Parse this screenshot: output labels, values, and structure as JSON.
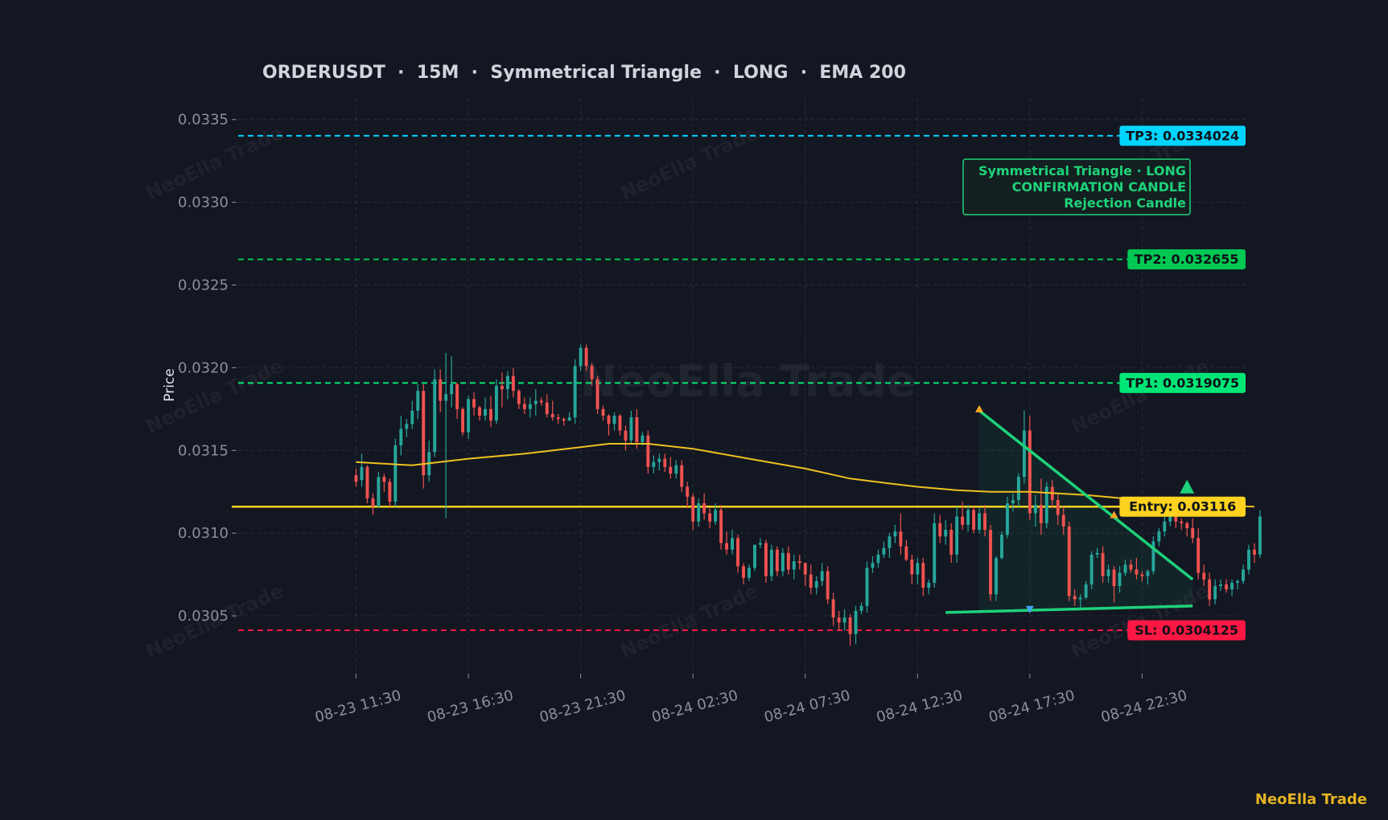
{
  "chart_data": {
    "type": "candlestick",
    "title": "ORDERUSDT  ·  15M  ·  Symmetrical Triangle  ·  LONG  ·  EMA 200",
    "ylabel": "Price",
    "ylim": [
      0.03016,
      0.03363
    ],
    "y_ticks": [
      "0.0305",
      "0.0310",
      "0.0315",
      "0.0320",
      "0.0325",
      "0.0330",
      "0.0335"
    ],
    "x_ticks": [
      "08-23 11:30",
      "08-23 16:30",
      "08-23 21:30",
      "08-24 02:30",
      "08-24 07:30",
      "08-24 12:30",
      "08-24 17:30",
      "08-24 22:30"
    ],
    "x_tick_index": [
      0,
      20,
      40,
      60,
      80,
      100,
      120,
      140
    ],
    "xlim": [
      -21,
      159
    ],
    "grid": true,
    "colors": {
      "up": "#26a69a",
      "down": "#ef5350",
      "ema": "#f0c020",
      "entry": "#ffd21f",
      "tp3": "#00d4ff",
      "tp2": "#00c853",
      "tp1": "#00e676",
      "sl": "#ff1744",
      "pattern": "#1ed27a",
      "brand": "#e6b422"
    },
    "candles": [
      [
        0.03135,
        0.03139,
        0.03128,
        0.03131
      ],
      [
        0.03132,
        0.03148,
        0.03128,
        0.0314
      ],
      [
        0.0314,
        0.03141,
        0.03118,
        0.03121
      ],
      [
        0.03121,
        0.03124,
        0.03111,
        0.03116
      ],
      [
        0.03116,
        0.03137,
        0.03116,
        0.03134
      ],
      [
        0.03134,
        0.03136,
        0.03125,
        0.03131
      ],
      [
        0.03131,
        0.03133,
        0.03116,
        0.03119
      ],
      [
        0.03119,
        0.03157,
        0.03116,
        0.03153
      ],
      [
        0.03153,
        0.03171,
        0.03147,
        0.03163
      ],
      [
        0.03163,
        0.03169,
        0.03158,
        0.03166
      ],
      [
        0.03166,
        0.0318,
        0.03163,
        0.03174
      ],
      [
        0.03174,
        0.0319,
        0.03169,
        0.03186
      ],
      [
        0.03186,
        0.0319,
        0.03127,
        0.03135
      ],
      [
        0.03135,
        0.03156,
        0.03131,
        0.03149
      ],
      [
        0.03149,
        0.03199,
        0.03146,
        0.03193
      ],
      [
        0.03193,
        0.03199,
        0.03173,
        0.0318
      ],
      [
        0.0318,
        0.03209,
        0.03109,
        0.03184
      ],
      [
        0.03184,
        0.03207,
        0.03176,
        0.0319
      ],
      [
        0.0319,
        0.03191,
        0.03169,
        0.03175
      ],
      [
        0.03175,
        0.03176,
        0.03159,
        0.03161
      ],
      [
        0.03161,
        0.03183,
        0.03157,
        0.03181
      ],
      [
        0.03181,
        0.03185,
        0.03171,
        0.03176
      ],
      [
        0.03176,
        0.03177,
        0.03168,
        0.03171
      ],
      [
        0.03171,
        0.03182,
        0.03168,
        0.03175
      ],
      [
        0.03175,
        0.03183,
        0.03164,
        0.03168
      ],
      [
        0.03168,
        0.03193,
        0.03166,
        0.03189
      ],
      [
        0.03189,
        0.03197,
        0.03176,
        0.03187
      ],
      [
        0.03187,
        0.03198,
        0.03181,
        0.03195
      ],
      [
        0.03195,
        0.032,
        0.03182,
        0.03186
      ],
      [
        0.03186,
        0.03187,
        0.03175,
        0.03178
      ],
      [
        0.03178,
        0.03182,
        0.03172,
        0.03175
      ],
      [
        0.03175,
        0.03182,
        0.0317,
        0.03178
      ],
      [
        0.03178,
        0.03187,
        0.03171,
        0.0318
      ],
      [
        0.0318,
        0.03182,
        0.03177,
        0.03179
      ],
      [
        0.03179,
        0.03184,
        0.0317,
        0.03172
      ],
      [
        0.03172,
        0.0318,
        0.03168,
        0.0317
      ],
      [
        0.0317,
        0.03172,
        0.03166,
        0.03169
      ],
      [
        0.03169,
        0.0317,
        0.03165,
        0.03168
      ],
      [
        0.03168,
        0.03173,
        0.03168,
        0.0317
      ],
      [
        0.0317,
        0.03205,
        0.03166,
        0.03201
      ],
      [
        0.03201,
        0.03214,
        0.03198,
        0.03212
      ],
      [
        0.03212,
        0.03214,
        0.03198,
        0.03201
      ],
      [
        0.03201,
        0.03203,
        0.03189,
        0.03193
      ],
      [
        0.03193,
        0.03195,
        0.03172,
        0.03175
      ],
      [
        0.03175,
        0.03177,
        0.03168,
        0.03171
      ],
      [
        0.03171,
        0.03172,
        0.03159,
        0.03166
      ],
      [
        0.03166,
        0.03173,
        0.03162,
        0.03171
      ],
      [
        0.03171,
        0.03172,
        0.03159,
        0.03162
      ],
      [
        0.03162,
        0.03165,
        0.0315,
        0.03156
      ],
      [
        0.03156,
        0.03174,
        0.03154,
        0.0317
      ],
      [
        0.0317,
        0.03175,
        0.03151,
        0.03155
      ],
      [
        0.03155,
        0.03161,
        0.03153,
        0.03159
      ],
      [
        0.03159,
        0.03162,
        0.03136,
        0.0314
      ],
      [
        0.0314,
        0.03147,
        0.03136,
        0.03143
      ],
      [
        0.03143,
        0.03148,
        0.03138,
        0.03145
      ],
      [
        0.03145,
        0.03148,
        0.03137,
        0.0314
      ],
      [
        0.0314,
        0.03146,
        0.03133,
        0.03136
      ],
      [
        0.03136,
        0.03144,
        0.03133,
        0.03141
      ],
      [
        0.03141,
        0.03144,
        0.03125,
        0.03128
      ],
      [
        0.03128,
        0.03131,
        0.03115,
        0.03122
      ],
      [
        0.03122,
        0.03124,
        0.03102,
        0.03107
      ],
      [
        0.03107,
        0.03121,
        0.03104,
        0.03118
      ],
      [
        0.03118,
        0.03124,
        0.03108,
        0.03112
      ],
      [
        0.03112,
        0.03115,
        0.03103,
        0.03107
      ],
      [
        0.03107,
        0.03118,
        0.03105,
        0.03114
      ],
      [
        0.03114,
        0.03117,
        0.0309,
        0.03094
      ],
      [
        0.03094,
        0.03101,
        0.03087,
        0.0309
      ],
      [
        0.0309,
        0.03102,
        0.03087,
        0.03097
      ],
      [
        0.03097,
        0.03099,
        0.03076,
        0.0308
      ],
      [
        0.0308,
        0.03082,
        0.03069,
        0.03073
      ],
      [
        0.03073,
        0.03081,
        0.03071,
        0.03079
      ],
      [
        0.03079,
        0.03093,
        0.03077,
        0.03093
      ],
      [
        0.03093,
        0.03097,
        0.03091,
        0.03094
      ],
      [
        0.03094,
        0.03096,
        0.0307,
        0.03074
      ],
      [
        0.03074,
        0.03093,
        0.03071,
        0.0309
      ],
      [
        0.0309,
        0.03092,
        0.03074,
        0.03077
      ],
      [
        0.03077,
        0.03091,
        0.03074,
        0.03088
      ],
      [
        0.03088,
        0.03092,
        0.03075,
        0.03078
      ],
      [
        0.03078,
        0.03087,
        0.03072,
        0.03083
      ],
      [
        0.03083,
        0.03087,
        0.03078,
        0.03082
      ],
      [
        0.03082,
        0.0308,
        0.03068,
        0.03075
      ],
      [
        0.03075,
        0.03081,
        0.03063,
        0.03067
      ],
      [
        0.03067,
        0.03074,
        0.03063,
        0.03071
      ],
      [
        0.03071,
        0.03082,
        0.03068,
        0.03077
      ],
      [
        0.03077,
        0.0308,
        0.03057,
        0.0306
      ],
      [
        0.0306,
        0.03064,
        0.03044,
        0.03049
      ],
      [
        0.03049,
        0.03053,
        0.03041,
        0.03046
      ],
      [
        0.03046,
        0.03054,
        0.03041,
        0.03049
      ],
      [
        0.03049,
        0.03051,
        0.03032,
        0.03039
      ],
      [
        0.03039,
        0.03056,
        0.03033,
        0.03053
      ],
      [
        0.03053,
        0.03058,
        0.03051,
        0.03056
      ],
      [
        0.03056,
        0.03083,
        0.03052,
        0.03079
      ],
      [
        0.03079,
        0.03086,
        0.03076,
        0.03082
      ],
      [
        0.03082,
        0.0309,
        0.03079,
        0.03087
      ],
      [
        0.03087,
        0.03095,
        0.03085,
        0.03091
      ],
      [
        0.03091,
        0.031,
        0.03085,
        0.03098
      ],
      [
        0.03098,
        0.03105,
        0.03094,
        0.03101
      ],
      [
        0.03101,
        0.03112,
        0.03087,
        0.03092
      ],
      [
        0.03092,
        0.03096,
        0.03083,
        0.03084
      ],
      [
        0.03084,
        0.03087,
        0.03069,
        0.03075
      ],
      [
        0.03075,
        0.03085,
        0.03069,
        0.03082
      ],
      [
        0.03082,
        0.03085,
        0.03062,
        0.03067
      ],
      [
        0.03067,
        0.03072,
        0.03063,
        0.0307
      ],
      [
        0.0307,
        0.03112,
        0.03067,
        0.03106
      ],
      [
        0.03106,
        0.03111,
        0.03094,
        0.03098
      ],
      [
        0.03098,
        0.03108,
        0.03093,
        0.03102
      ],
      [
        0.03102,
        0.03106,
        0.03082,
        0.03087
      ],
      [
        0.03087,
        0.03116,
        0.03082,
        0.0311
      ],
      [
        0.0311,
        0.03119,
        0.03102,
        0.03105
      ],
      [
        0.03105,
        0.03117,
        0.03101,
        0.03114
      ],
      [
        0.03114,
        0.03116,
        0.031,
        0.03102
      ],
      [
        0.03102,
        0.03115,
        0.031,
        0.03112
      ],
      [
        0.03112,
        0.03117,
        0.03098,
        0.03102
      ],
      [
        0.03102,
        0.03105,
        0.03059,
        0.03063
      ],
      [
        0.03063,
        0.03086,
        0.03059,
        0.03085
      ],
      [
        0.03085,
        0.03101,
        0.03084,
        0.03099
      ],
      [
        0.03099,
        0.03122,
        0.03097,
        0.03118
      ],
      [
        0.03118,
        0.03124,
        0.03113,
        0.0312
      ],
      [
        0.0312,
        0.03136,
        0.03116,
        0.03134
      ],
      [
        0.03134,
        0.03174,
        0.0313,
        0.03162
      ],
      [
        0.03162,
        0.03171,
        0.03108,
        0.03112
      ],
      [
        0.03112,
        0.03123,
        0.03104,
        0.03117
      ],
      [
        0.03117,
        0.03133,
        0.03099,
        0.03106
      ],
      [
        0.03106,
        0.03131,
        0.03103,
        0.03128
      ],
      [
        0.03128,
        0.03132,
        0.03115,
        0.0312
      ],
      [
        0.0312,
        0.03124,
        0.03105,
        0.03111
      ],
      [
        0.03111,
        0.03116,
        0.03099,
        0.03104
      ],
      [
        0.03104,
        0.03107,
        0.03059,
        0.03062
      ],
      [
        0.03062,
        0.03066,
        0.03056,
        0.0306
      ],
      [
        0.0306,
        0.03063,
        0.03055,
        0.03061
      ],
      [
        0.03061,
        0.03071,
        0.0306,
        0.03069
      ],
      [
        0.03069,
        0.03089,
        0.03066,
        0.03087
      ],
      [
        0.03087,
        0.03091,
        0.03085,
        0.03088
      ],
      [
        0.03088,
        0.03092,
        0.0307,
        0.03074
      ],
      [
        0.03074,
        0.03081,
        0.0307,
        0.03078
      ],
      [
        0.03078,
        0.0308,
        0.03058,
        0.03068
      ],
      [
        0.03068,
        0.0308,
        0.03064,
        0.03076
      ],
      [
        0.03076,
        0.03084,
        0.03074,
        0.03081
      ],
      [
        0.03081,
        0.03084,
        0.03076,
        0.03078
      ],
      [
        0.03078,
        0.03085,
        0.03072,
        0.03075
      ],
      [
        0.03075,
        0.03077,
        0.03071,
        0.03074
      ],
      [
        0.03074,
        0.03078,
        0.03069,
        0.03077
      ],
      [
        0.03077,
        0.03098,
        0.03075,
        0.03095
      ],
      [
        0.03095,
        0.03103,
        0.03092,
        0.03101
      ],
      [
        0.03101,
        0.0311,
        0.03098,
        0.03107
      ],
      [
        0.03107,
        0.03114,
        0.03104,
        0.03112
      ],
      [
        0.03112,
        0.03113,
        0.03103,
        0.03107
      ],
      [
        0.03107,
        0.03109,
        0.03102,
        0.03106
      ],
      [
        0.03106,
        0.03107,
        0.03098,
        0.03103
      ],
      [
        0.03103,
        0.03109,
        0.03094,
        0.03097
      ],
      [
        0.03097,
        0.03103,
        0.03072,
        0.03076
      ],
      [
        0.03076,
        0.03081,
        0.03068,
        0.03072
      ],
      [
        0.03072,
        0.03076,
        0.03056,
        0.0306
      ],
      [
        0.0306,
        0.03072,
        0.03057,
        0.03068
      ],
      [
        0.03068,
        0.03072,
        0.03065,
        0.03069
      ],
      [
        0.03069,
        0.03072,
        0.03064,
        0.03066
      ],
      [
        0.03066,
        0.03072,
        0.03062,
        0.0307
      ],
      [
        0.0307,
        0.03072,
        0.03066,
        0.03071
      ],
      [
        0.03071,
        0.03081,
        0.03069,
        0.03078
      ],
      [
        0.03078,
        0.03093,
        0.03075,
        0.0309
      ],
      [
        0.0309,
        0.03094,
        0.03082,
        0.03087
      ],
      [
        0.03087,
        0.03114,
        0.03085,
        0.0311
      ]
    ],
    "ema": {
      "name": "EMA 200",
      "points": [
        [
          0,
          0.03143
        ],
        [
          10,
          0.03141
        ],
        [
          20,
          0.03145
        ],
        [
          30,
          0.03148
        ],
        [
          40,
          0.03152
        ],
        [
          45,
          0.03154
        ],
        [
          52,
          0.03154
        ],
        [
          60,
          0.03151
        ],
        [
          70,
          0.03145
        ],
        [
          80,
          0.03139
        ],
        [
          88,
          0.03133
        ],
        [
          95,
          0.0313
        ],
        [
          100,
          0.03128
        ],
        [
          107,
          0.03126
        ],
        [
          113,
          0.03125
        ],
        [
          120,
          0.03125
        ],
        [
          130,
          0.03123
        ],
        [
          140,
          0.0312
        ],
        [
          150,
          0.03117
        ],
        [
          160,
          0.03116
        ]
      ]
    },
    "levels": [
      {
        "key": "tp3",
        "label": "TP3: 0.0334024",
        "value": 0.0334024,
        "style": "dashed"
      },
      {
        "key": "tp2",
        "label": "TP2: 0.032655",
        "value": 0.032655,
        "style": "dashed"
      },
      {
        "key": "tp1",
        "label": "TP1: 0.0319075",
        "value": 0.0319075,
        "style": "dashed"
      },
      {
        "key": "entry",
        "label": "Entry: 0.03116",
        "value": 0.03116,
        "style": "solid"
      },
      {
        "key": "sl",
        "label": "SL: 0.0304125",
        "value": 0.0304125,
        "style": "dashed"
      }
    ],
    "triangle": {
      "upper": [
        [
          111,
          0.03174
        ],
        [
          149,
          0.03072
        ]
      ],
      "lower": [
        [
          105,
          0.03052
        ],
        [
          149,
          0.03056
        ]
      ],
      "fill_from_x": 111
    },
    "markers": [
      {
        "type": "pivot-high",
        "x": 111,
        "y": 0.03175
      },
      {
        "type": "pivot-low",
        "x": 120,
        "y": 0.03054
      },
      {
        "type": "pivot-high",
        "x": 135,
        "y": 0.03111
      },
      {
        "type": "long-signal",
        "x": 148,
        "y": 0.03124
      }
    ],
    "annotation": [
      "Symmetrical Triangle · LONG",
      "CONFIRMATION CANDLE",
      "Rejection Candle"
    ],
    "center_watermark": "NeoElla Trade",
    "watermark": "NeoElla Trade",
    "brand": "NeoElla Trade"
  }
}
